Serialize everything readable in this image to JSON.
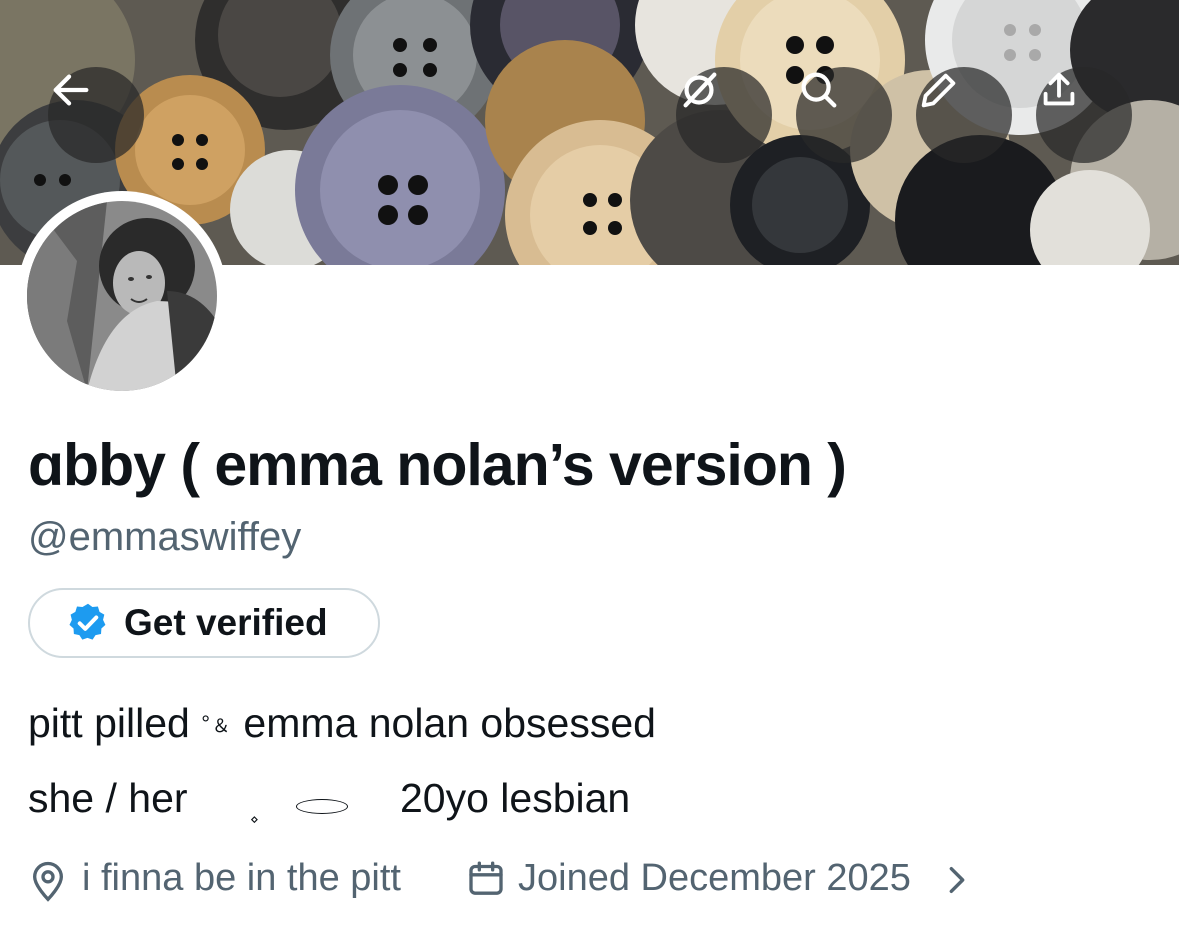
{
  "header": {
    "back_icon": "arrow-left-icon",
    "grok_icon": "grok-icon",
    "search_icon": "search-icon",
    "edit_icon": "pencil-icon",
    "share_icon": "share-upload-icon"
  },
  "profile": {
    "display_name": "ɑbby ( emma nolan’s version )",
    "handle": "@emmaswiffey",
    "verify_button_label": "Get verified",
    "bio": {
      "line1_before": "pitt pilled ",
      "line1_small": "°﹠",
      "line1_after": " emma nolan obsessed",
      "pronouns": "she / her",
      "diamond": "⋄",
      "age": "20yo lesbian"
    },
    "location": "i finna be in the pitt",
    "joined": "Joined December 2025"
  },
  "colors": {
    "text_primary": "#0f1419",
    "text_secondary": "#536471",
    "verified_blue": "#1d9bf0",
    "border": "#cfd9de"
  }
}
